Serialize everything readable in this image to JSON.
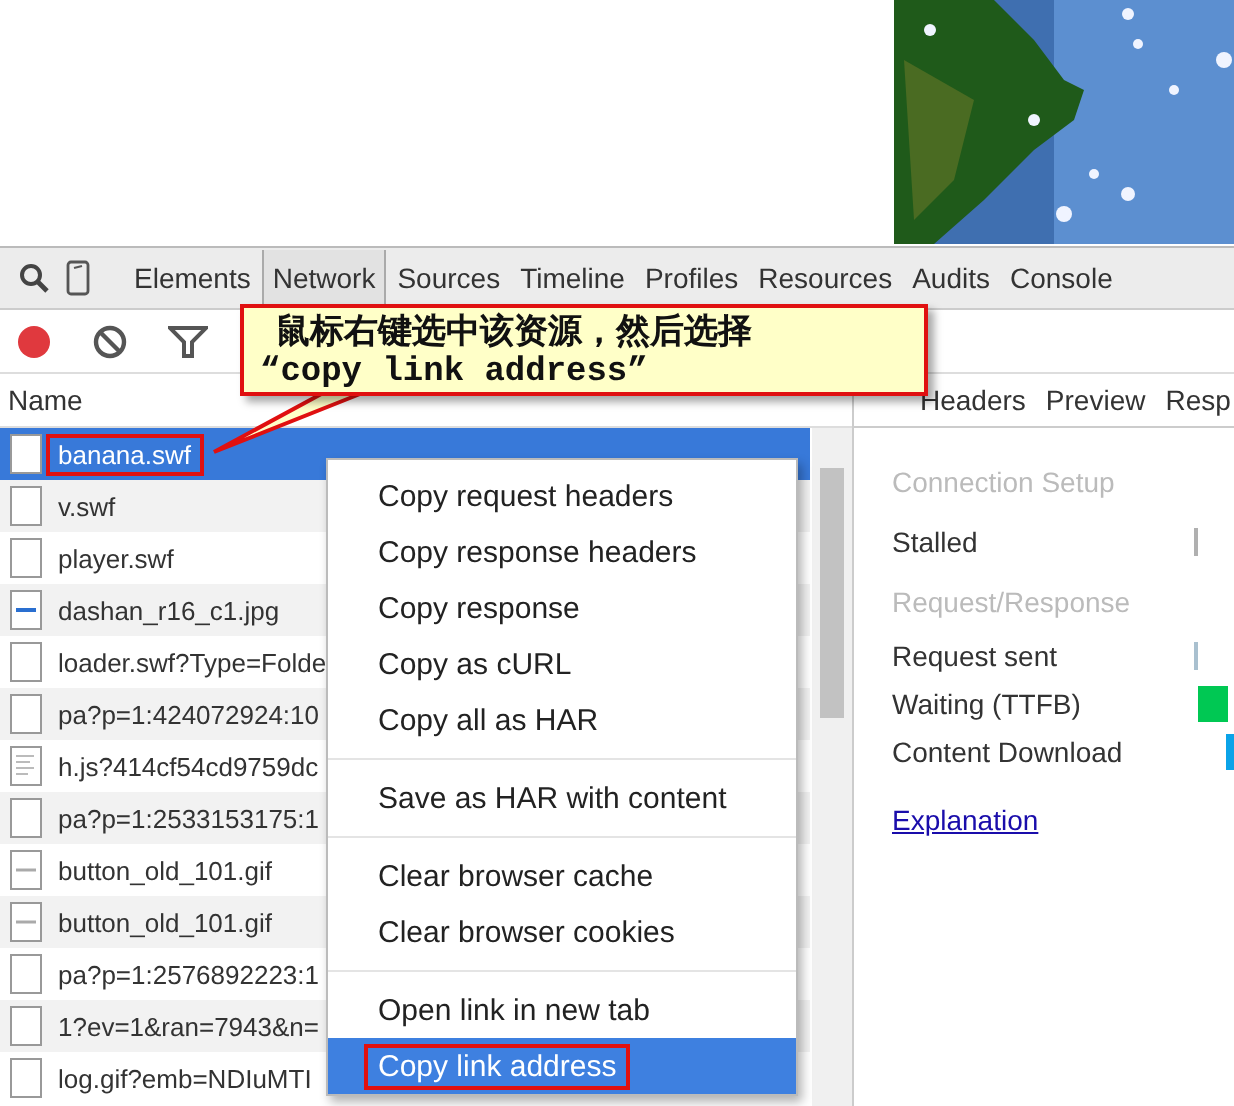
{
  "devtools_tabs": [
    {
      "label": "Elements",
      "selected": false
    },
    {
      "label": "Network",
      "selected": true
    },
    {
      "label": "Sources",
      "selected": false
    },
    {
      "label": "Timeline",
      "selected": false
    },
    {
      "label": "Profiles",
      "selected": false
    },
    {
      "label": "Resources",
      "selected": false
    },
    {
      "label": "Audits",
      "selected": false
    },
    {
      "label": "Console",
      "selected": false
    }
  ],
  "toolbar": {
    "recording": true
  },
  "callout": {
    "lines": [
      "鼠标右键选中该资源，然后选择",
      "“copy link address”"
    ]
  },
  "requests": {
    "column": "Name",
    "rows": [
      {
        "name": "banana.swf",
        "kind": "blank",
        "selected": true,
        "annotated": true
      },
      {
        "name": "v.swf",
        "kind": "blank",
        "selected": false,
        "annotated": false
      },
      {
        "name": "player.swf",
        "kind": "blank",
        "selected": false,
        "annotated": false
      },
      {
        "name": "dashan_r16_c1.jpg",
        "selected": false,
        "annotated": false
      },
      {
        "name": "loader.swf?Type=Folde",
        "kind": "blank",
        "selected": false,
        "annotated": false
      },
      {
        "name": "pa?p=1:424072924:10",
        "kind": "blank",
        "selected": false,
        "annotated": false
      },
      {
        "name": "h.js?414cf54cd9759dc",
        "kind": "script",
        "selected": false,
        "annotated": false
      },
      {
        "name": "pa?p=1:2533153175:1",
        "kind": "blank",
        "selected": false,
        "annotated": false
      },
      {
        "name": "button_old_101.gif",
        "kind": "gif",
        "selected": false,
        "annotated": false
      },
      {
        "name": "button_old_101.gif",
        "kind": "gif",
        "selected": false,
        "annotated": false
      },
      {
        "name": "pa?p=1:2576892223:1",
        "kind": "blank",
        "selected": false,
        "annotated": false
      },
      {
        "name": "1?ev=1&ran=7943&n=",
        "kind": "blank",
        "selected": false,
        "annotated": false
      },
      {
        "name": "log.gif?emb=NDIuMTI",
        "kind": "blank",
        "selected": false,
        "annotated": false
      }
    ]
  },
  "context_menu": {
    "groups": [
      [
        {
          "label": "Copy request headers",
          "selected": false,
          "annotated": false
        },
        {
          "label": "Copy response headers",
          "selected": false,
          "annotated": false
        },
        {
          "label": "Copy response",
          "selected": false,
          "annotated": false
        },
        {
          "label": "Copy as cURL",
          "selected": false,
          "annotated": false
        },
        {
          "label": "Copy all as HAR",
          "selected": false,
          "annotated": false
        }
      ],
      [
        {
          "label": "Save as HAR with content",
          "selected": false,
          "annotated": false
        }
      ],
      [
        {
          "label": "Clear browser cache",
          "selected": false,
          "annotated": false
        },
        {
          "label": "Clear browser cookies",
          "selected": false,
          "annotated": false
        }
      ],
      [
        {
          "label": "Open link in new tab",
          "selected": false,
          "annotated": false
        },
        {
          "label": "Copy link address",
          "selected": true,
          "annotated": true
        }
      ]
    ]
  },
  "detail_tabs": [
    {
      "label": "Headers"
    },
    {
      "label": "Preview"
    },
    {
      "label": "Resp"
    }
  ],
  "timing": [
    {
      "kind": "heading",
      "label": "Connection Setup"
    },
    {
      "kind": "tick",
      "label": "Stalled",
      "color": "#b0b0b0"
    },
    {
      "kind": "heading",
      "label": "Request/Response"
    },
    {
      "kind": "tick",
      "label": "Request sent",
      "color": "#a9c0cf"
    },
    {
      "kind": "block",
      "label": "Waiting (TTFB)",
      "color": "#00c853"
    },
    {
      "kind": "edge",
      "label": "Content Download",
      "color": "#0aa3e8"
    }
  ],
  "explanation_link": "Explanation"
}
